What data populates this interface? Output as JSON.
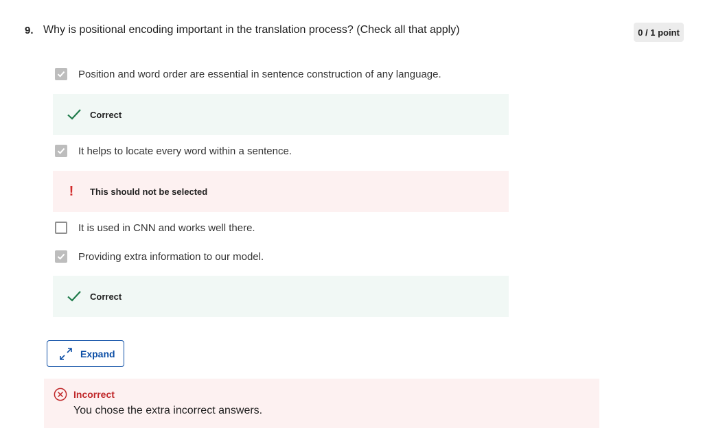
{
  "question": {
    "number": "9.",
    "text": "Why is positional encoding important in the translation process? (Check all that apply)",
    "points": "0 / 1 point"
  },
  "options": [
    {
      "label": "Position and word order are essential in sentence construction of any language.",
      "checked": true,
      "feedback": {
        "type": "correct",
        "text": "Correct",
        "icon": "checkmark-icon"
      }
    },
    {
      "label": "It helps to locate every word within a sentence.",
      "checked": true,
      "feedback": {
        "type": "wrong",
        "text": "This should not be selected",
        "icon": "exclamation-icon"
      }
    },
    {
      "label": "It is used in CNN and works well there.",
      "checked": false
    },
    {
      "label": "Providing extra information to our model.",
      "checked": true,
      "feedback": {
        "type": "correct",
        "text": "Correct",
        "icon": "checkmark-icon"
      }
    }
  ],
  "expand": {
    "label": "Expand",
    "icon": "expand-arrows-icon"
  },
  "result": {
    "title": "Incorrect",
    "message": "You chose the extra incorrect answers.",
    "icon": "x-circle-icon"
  },
  "colors": {
    "correct_check": "#1e7a4a",
    "correct_bg": "#f1f8f5",
    "wrong_bg": "#fdf1f1",
    "wrong_accent": "#c0282a",
    "link_blue": "#0d4fa6",
    "checkbox_checked": "#bdbdbd"
  }
}
